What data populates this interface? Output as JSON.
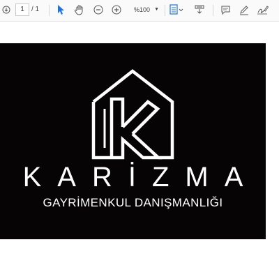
{
  "toolbar": {
    "page_current": "1",
    "page_total": "/ 1",
    "zoom": "%100",
    "icons": [
      "download-icon",
      "cursor-icon",
      "hand-icon",
      "zoom-out-icon",
      "zoom-in-icon",
      "fit-page-icon",
      "scroll-icon",
      "comment-icon",
      "pen-icon",
      "sign-icon"
    ]
  },
  "document": {
    "brand_name": "KARİZMA",
    "brand_subtitle": "GAYRİMENKUL DANIŞMANLIĞI",
    "background_color": "#060405",
    "text_color": "#ffffff"
  }
}
